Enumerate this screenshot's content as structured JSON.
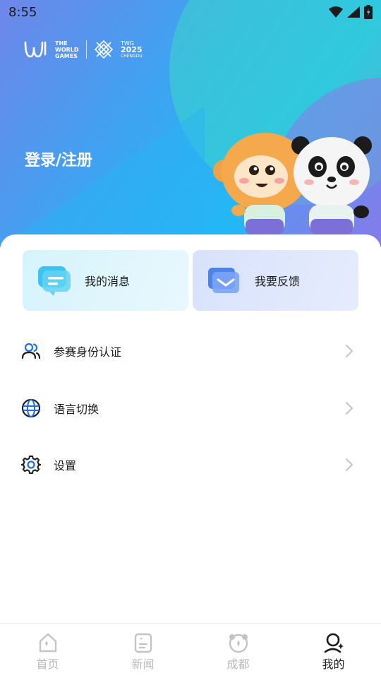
{
  "status_bar": {
    "time": "8:55",
    "icons": [
      "wifi-icon",
      "signal-icon",
      "battery-icon"
    ]
  },
  "logo": {
    "world_games": "THE WORLD GAMES",
    "event": "TWG",
    "year": "2025",
    "city": "CHENGDU"
  },
  "header": {
    "login_label": "登录/注册"
  },
  "quick_actions": [
    {
      "label": "我的消息",
      "icon": "message-icon"
    },
    {
      "label": "我要反馈",
      "icon": "feedback-mail-icon"
    }
  ],
  "menu": [
    {
      "label": "参赛身份认证",
      "icon": "users-icon"
    },
    {
      "label": "语言切换",
      "icon": "globe-icon"
    },
    {
      "label": "设置",
      "icon": "gear-icon"
    }
  ],
  "bottom_nav": [
    {
      "label": "首页",
      "icon": "home-icon",
      "active": false
    },
    {
      "label": "新闻",
      "icon": "news-icon",
      "active": false
    },
    {
      "label": "成都",
      "icon": "panda-icon",
      "active": false
    },
    {
      "label": "我的",
      "icon": "profile-icon",
      "active": true
    }
  ],
  "colors": {
    "accent": "#1e6fe0",
    "active_text": "#1a1a1a",
    "inactive_text": "#b8b8b8"
  }
}
